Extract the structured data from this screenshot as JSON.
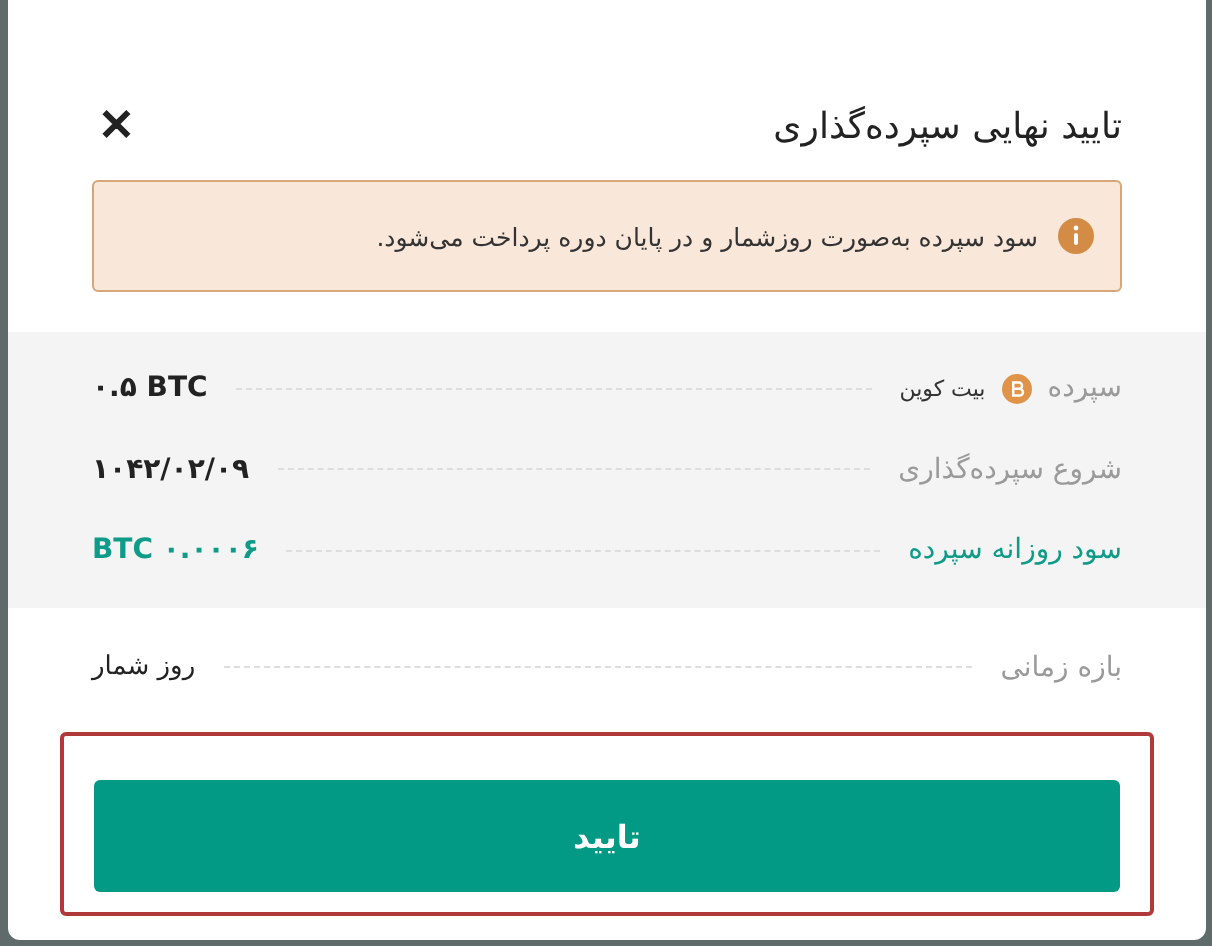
{
  "dialog": {
    "title": "تایید نهایی سپرده‌گذاری",
    "close": "✕"
  },
  "notice": {
    "text": "سود سپرده به‌صورت روزشمار و در پایان دوره پرداخت می‌شود."
  },
  "summary_rows": [
    {
      "kind": "asset",
      "label": "سپرده",
      "asset": "بیت کوین",
      "value": "۰.۵ BTC"
    },
    {
      "kind": "plain",
      "label": "شروع سپرده‌گذاری",
      "value": "۱۰۴۲/۰۲/۰۹"
    },
    {
      "kind": "highlight",
      "label": "سود روزانه سپرده",
      "value": "BTC ۰.۰۰۰۶"
    }
  ],
  "detail_rows": [
    {
      "label": "بازه زمانی",
      "value": "روز شمار"
    }
  ],
  "confirm_button": {
    "label": "تایید",
    "outlined": true
  }
}
